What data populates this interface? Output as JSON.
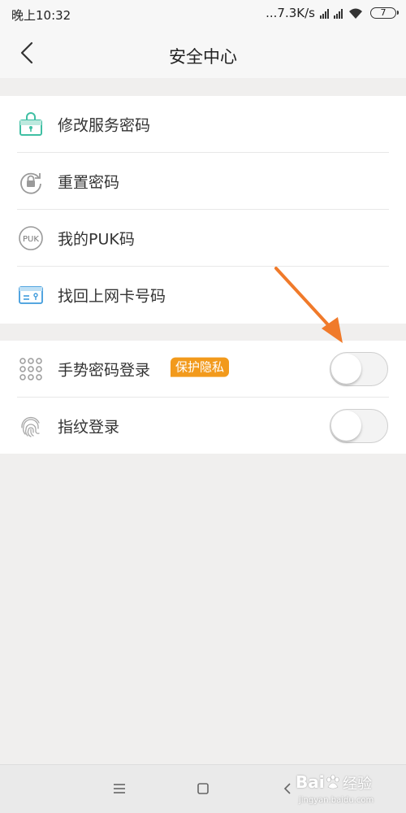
{
  "status_bar": {
    "time": "晚上10:32",
    "network_speed": "...7.3K/s",
    "battery_level": "7"
  },
  "header": {
    "title": "安全中心",
    "back_icon": "chevron-left-icon"
  },
  "section_1": {
    "items": [
      {
        "label": "修改服务密码",
        "icon": "lock-card-icon"
      },
      {
        "label": "重置密码",
        "icon": "lock-reset-icon"
      },
      {
        "label": "我的PUK码",
        "icon": "puk-icon"
      },
      {
        "label": "找回上网卡号码",
        "icon": "sim-card-icon"
      }
    ]
  },
  "section_2": {
    "items": [
      {
        "label": "手势密码登录",
        "icon": "gesture-grid-icon",
        "badge": "保护隐私",
        "toggle_on": false
      },
      {
        "label": "指纹登录",
        "icon": "fingerprint-icon",
        "toggle_on": false
      }
    ]
  },
  "nav_bar": {
    "buttons": [
      "menu-icon",
      "home-square-icon",
      "back-chevron-icon"
    ]
  },
  "watermark": {
    "logo_text": "Bai",
    "logo_tail": "",
    "experience": "经验",
    "url": "jingyan.baidu.com"
  },
  "colors": {
    "accent_teal": "#3fbfa3",
    "badge_orange": "#f29a1c",
    "arrow_orange": "#f07a2a",
    "icon_gray": "#9a9a9a",
    "puk_blue": "#3f9bdc"
  }
}
